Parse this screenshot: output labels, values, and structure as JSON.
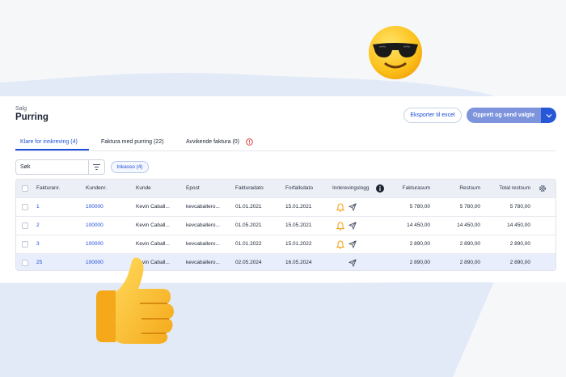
{
  "breadcrumb": "Salg",
  "title": "Purring",
  "actions": {
    "export_label": "Eksporter til excel",
    "primary_label": "Opprett og send valgte"
  },
  "tabs": [
    {
      "label": "Klare for innkreving (4)",
      "active": true
    },
    {
      "label": "Faktura med purring (22)",
      "active": false
    },
    {
      "label": "Avvikende faktura (0)",
      "active": false
    }
  ],
  "search": {
    "value": "Søk"
  },
  "filter_chip": "Inkasso (4)",
  "table": {
    "headers": [
      "Fakturanr.",
      "Kundenr.",
      "Kunde",
      "Epost",
      "Fakturadato",
      "Forfallsdato",
      "Innkrevingslogg",
      "Fakturasum",
      "Restsum",
      "Total restsum"
    ],
    "rows": [
      {
        "fakturanr": "1",
        "kundenr": "100000",
        "kunde": "Kevin Caball...",
        "epost": "kevcaballero...",
        "fakturadato": "01.01.2021",
        "forfallsdato": "15.01.2021",
        "has_bell": true,
        "fakturasum": "5 780,00",
        "restsum": "5 780,00",
        "total": "5 780,00",
        "selected": false
      },
      {
        "fakturanr": "2",
        "kundenr": "100000",
        "kunde": "Kevin Caball...",
        "epost": "kevcaballero...",
        "fakturadato": "01.05.2021",
        "forfallsdato": "15.05.2021",
        "has_bell": true,
        "fakturasum": "14 450,00",
        "restsum": "14 450,00",
        "total": "14 450,00",
        "selected": false
      },
      {
        "fakturanr": "3",
        "kundenr": "100000",
        "kunde": "Kevin Caball...",
        "epost": "kevcaballero...",
        "fakturadato": "01.01.2022",
        "forfallsdato": "15.01.2022",
        "has_bell": true,
        "fakturasum": "2 890,00",
        "restsum": "2 890,00",
        "total": "2 890,00",
        "selected": false
      },
      {
        "fakturanr": "25",
        "kundenr": "100000",
        "kunde": "Kevin Caball...",
        "epost": "kevcaballero...",
        "fakturadato": "02.05.2024",
        "forfallsdato": "16.05.2024",
        "has_bell": false,
        "fakturasum": "2 890,00",
        "restsum": "2 890,00",
        "total": "2 890,00",
        "selected": true
      }
    ]
  },
  "colors": {
    "accent": "#1d4ed8",
    "primary_button": "#7d94dd",
    "bell": "#f59e0b",
    "warning": "#dc2626",
    "selected_row": "#e8eefc",
    "wave": "#e2eaf8"
  },
  "icons": [
    "sunglasses-emoji",
    "thumbs-up-emoji",
    "chevron-down-icon",
    "warning-icon",
    "filter-icon",
    "info-icon",
    "gear-icon",
    "bell-icon",
    "send-icon"
  ]
}
